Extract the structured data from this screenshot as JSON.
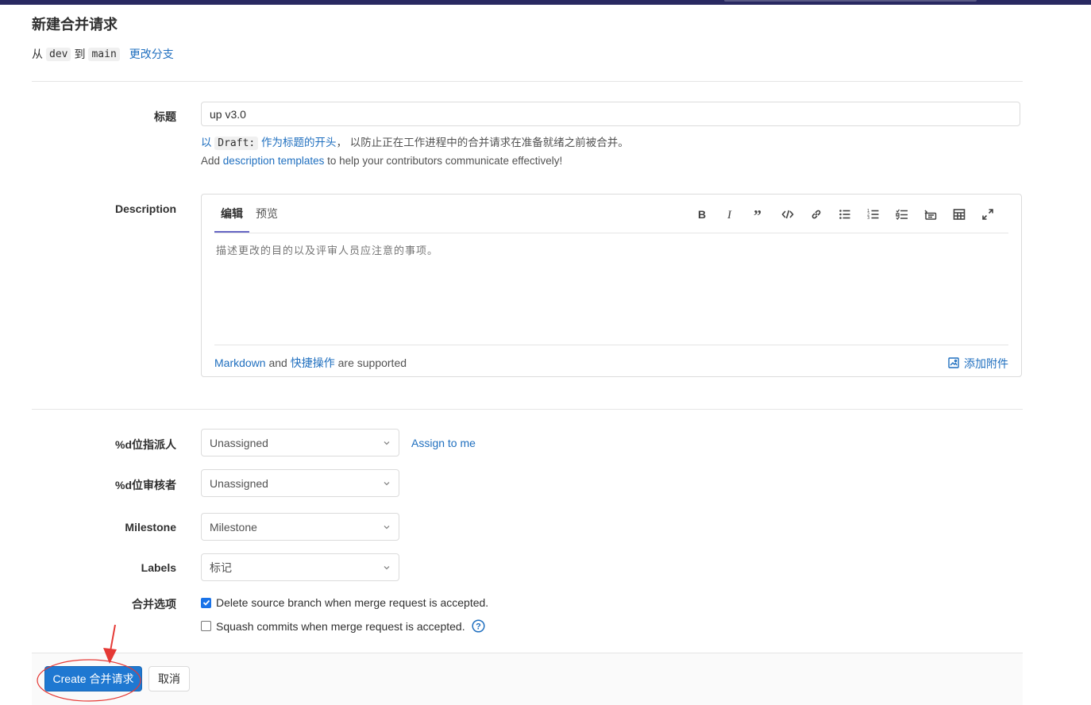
{
  "page": {
    "title": "新建合并请求",
    "branch": {
      "from_text": "从",
      "source": "dev",
      "to_text": "到",
      "target": "main",
      "change_link": "更改分支"
    }
  },
  "title_field": {
    "label": "标题",
    "value": "up v3.0",
    "draft_hint": {
      "prefix": "以",
      "code": "Draft:",
      "link": "作为标题的开头",
      "suffix": "， 以防止正在工作进程中的合并请求在准备就绪之前被合并。"
    },
    "templates_hint": {
      "prefix": "Add",
      "link": "description templates",
      "suffix": "to help your contributors communicate effectively!"
    }
  },
  "description": {
    "label": "Description",
    "tabs": [
      {
        "label": "编辑"
      },
      {
        "label": "预览"
      }
    ],
    "toolbar_icons": [
      "bold-icon",
      "italic-icon",
      "quote-icon",
      "code-icon",
      "link-icon",
      "bullet-list-icon",
      "numbered-list-icon",
      "task-list-icon",
      "collapsible-icon",
      "table-icon",
      "fullscreen-icon"
    ],
    "placeholder": "描述更改的目的以及评审人员应注意的事项。",
    "markdown_link": "Markdown",
    "and_text": "and",
    "shortcuts_link": "快捷操作",
    "supported_text": "are supported",
    "attach_label": "添加附件"
  },
  "assignee": {
    "label": "%d位指派人",
    "value": "Unassigned",
    "assign_me": "Assign to me"
  },
  "reviewer": {
    "label": "%d位审核者",
    "value": "Unassigned"
  },
  "milestone": {
    "label": "Milestone",
    "value": "Milestone"
  },
  "labels": {
    "label": "Labels",
    "value": "标记"
  },
  "merge_options": {
    "label": "合并选项",
    "delete_branch": {
      "text": "Delete source branch when merge request is accepted.",
      "checked": true
    },
    "squash": {
      "text": "Squash commits when merge request is accepted.",
      "checked": false
    }
  },
  "footer": {
    "create_label": "Create 合并请求",
    "cancel_label": "取消"
  },
  "colors": {
    "link": "#1f6fbf",
    "primary": "#1f78d1",
    "annotation": "#e53935",
    "topbar": "#292961"
  }
}
